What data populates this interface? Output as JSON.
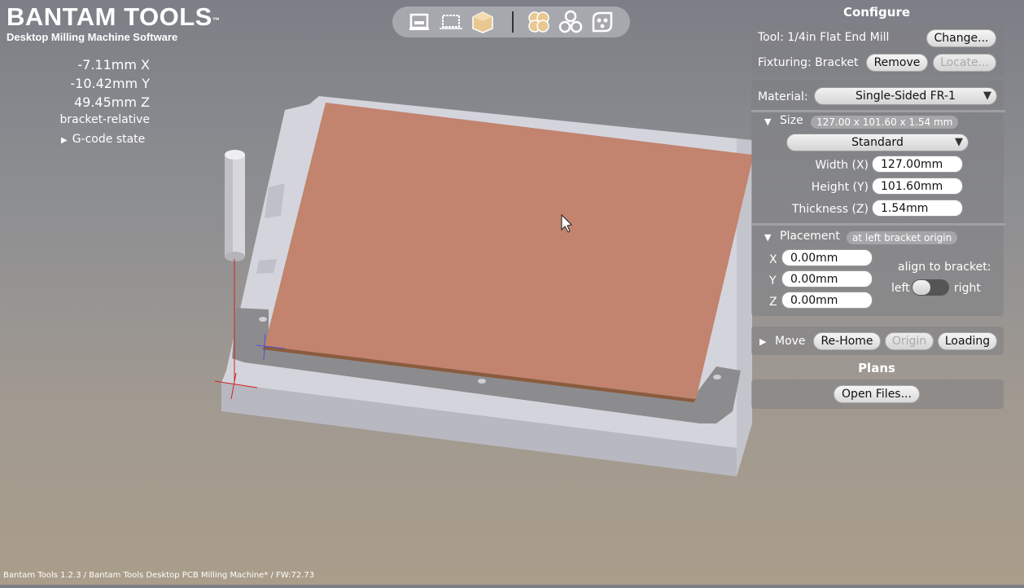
{
  "brand": {
    "title": "BANTAM TOOLS",
    "tm": "™",
    "subtitle": "Desktop Milling Machine Software"
  },
  "readout": {
    "x": "-7.11mm X",
    "y": "-10.42mm Y",
    "z": "49.45mm Z",
    "mode": "bracket-relative",
    "gcode_toggle": "G-code state"
  },
  "toolbar": {
    "icons": [
      "machine-view-icon",
      "bed-view-icon",
      "box-view-icon",
      "material-milled-icon",
      "circles-outline-icon",
      "pcb-holes-icon"
    ]
  },
  "configure": {
    "title": "Configure",
    "tool_label": "Tool: 1/4in Flat End Mill",
    "change_btn": "Change...",
    "fixturing_label": "Fixturing: Bracket",
    "remove_btn": "Remove",
    "locate_btn": "Locate...",
    "material_label": "Material:",
    "material_value": "Single-Sided FR-1",
    "size_label": "Size",
    "size_pill": "127.00 x 101.60 x 1.54 mm",
    "size_preset": "Standard",
    "width_label": "Width (X)",
    "width_value": "127.00mm",
    "height_label": "Height (Y)",
    "height_value": "101.60mm",
    "thickness_label": "Thickness (Z)",
    "thickness_value": "1.54mm",
    "placement_label": "Placement",
    "placement_pill": "at left bracket origin",
    "px_label": "X",
    "px_value": "0.00mm",
    "py_label": "Y",
    "py_value": "0.00mm",
    "pz_label": "Z",
    "pz_value": "0.00mm",
    "align_label": "align to bracket:",
    "align_left": "left",
    "align_right": "right",
    "move_label": "Move",
    "rehome_btn": "Re-Home",
    "origin_btn": "Origin",
    "loading_btn": "Loading"
  },
  "plans": {
    "title": "Plans",
    "open_btn": "Open Files..."
  },
  "status_bar": "Bantam Tools 1.2.3 / Bantam Tools Desktop PCB Milling Machine* / FW:72.73",
  "colors": {
    "copper": "#c2836f",
    "bed": "#cfcfd6",
    "bracket": "#8a8a8c"
  }
}
